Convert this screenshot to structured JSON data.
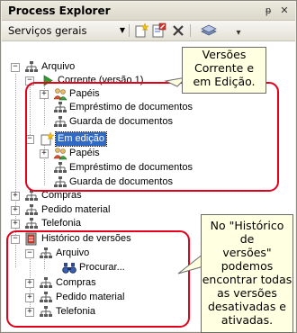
{
  "window": {
    "title": "Process Explorer"
  },
  "title_controls": {
    "pin": "ᵽ",
    "close": "✕"
  },
  "toolbar": {
    "combo_value": "Serviços gerais",
    "combo_arrow": "▼",
    "overflow": "▾",
    "icons": [
      "new-item-icon",
      "edit-document-icon",
      "delete-icon",
      "layers-icon"
    ]
  },
  "tree": {
    "arquivo": "Arquivo",
    "corrente": "Corrente (versão 1)",
    "papeis_1": "Papéis",
    "emprestimo_1": "Empréstimo de documentos",
    "guarda_1": "Guarda de documentos",
    "em_edicao": "Em edição",
    "papeis_2": "Papéis",
    "emprestimo_2": "Empréstimo de documentos",
    "guarda_2": "Guarda de documentos",
    "compras": "Compras",
    "pedido": "Pedido material",
    "telefonia": "Telefonia",
    "historico": "Histórico de versões",
    "h_arquivo": "Arquivo",
    "procurar": "Procurar...",
    "h_compras": "Compras",
    "h_pedido": "Pedido material",
    "h_telefonia": "Telefonia",
    "expanded_glyph": "−",
    "collapsed_glyph": "+"
  },
  "callouts": {
    "top": [
      "Versões",
      "Corrente e",
      "em Edição."
    ],
    "bottom": [
      "No \"Histórico de",
      "versões\"",
      "podemos",
      "encontrar todas",
      "as versões",
      "desativadas e",
      "ativadas."
    ]
  },
  "colors": {
    "selection": "#316ac5",
    "highlight_border": "#e2001a",
    "callout_bg": "#ffffe1"
  }
}
